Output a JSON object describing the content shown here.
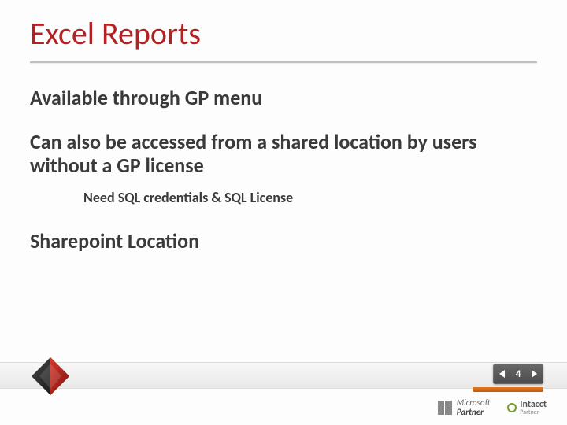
{
  "title": "Excel Reports",
  "body": {
    "p1": "Available through GP menu",
    "p2": "Can also be accessed from a shared location by users without a GP license",
    "p2_sub": "Need SQL credentials & SQL License",
    "p3": "Sharepoint Location"
  },
  "pager": {
    "page_number": "4"
  },
  "footer": {
    "ms_line1": "Microsoft",
    "ms_line2": "Partner",
    "intacct_name": "Intacct",
    "intacct_tag": "Partner"
  }
}
